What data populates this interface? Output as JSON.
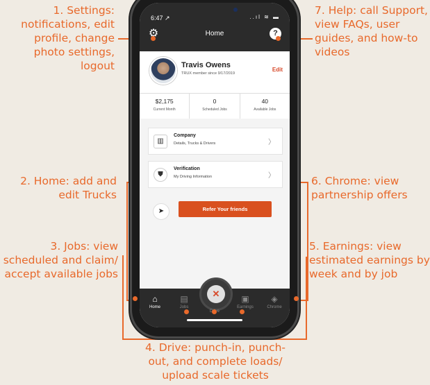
{
  "annotations": {
    "settings": "1. Settings: notifications, edit profile, change photo settings, logout",
    "home": "2. Home: add and edit Trucks",
    "jobs": "3. Jobs: view scheduled and claim/ accept available jobs",
    "drive": "4. Drive: punch-in, punch-out, and complete loads/ upload scale tickets",
    "earnings": "5. Earnings: view estimated earnings by week and by job",
    "chrome": "6. Chrome: view partnership offers",
    "help": "7. Help: call Support, view FAQs, user guides, and how-to videos"
  },
  "status": {
    "time": "6:47 ↗",
    "icons": "..ıl ≋ ▬"
  },
  "header": {
    "title": "Home",
    "help_icon": "?"
  },
  "profile": {
    "name": "Travis Owens",
    "since": "TRUX member since 9/17/2019",
    "edit_label": "Edit"
  },
  "stats": [
    {
      "value": "$2,175",
      "label": "Current Month"
    },
    {
      "value": "0",
      "label": "Scheduled Jobs"
    },
    {
      "value": "40",
      "label": "Available Jobs"
    }
  ],
  "cards": [
    {
      "title": "Company",
      "subtitle": "Details, Trucks & Drivers",
      "icon": "building-icon"
    },
    {
      "title": "Verification",
      "subtitle": "My Driving Information",
      "icon": "shield-icon"
    }
  ],
  "refer": {
    "label": "Refer Your friends"
  },
  "tabs": [
    {
      "label": "Home",
      "icon": "home-icon"
    },
    {
      "label": "Jobs",
      "icon": "jobs-icon"
    },
    {
      "label": "Drive",
      "icon": "drive-icon"
    },
    {
      "label": "Earnings",
      "icon": "earnings-icon"
    },
    {
      "label": "Chrome",
      "icon": "chrome-icon"
    }
  ],
  "colors": {
    "accent": "#e8692b",
    "button": "#d9501f",
    "background": "#f0ebe3"
  }
}
